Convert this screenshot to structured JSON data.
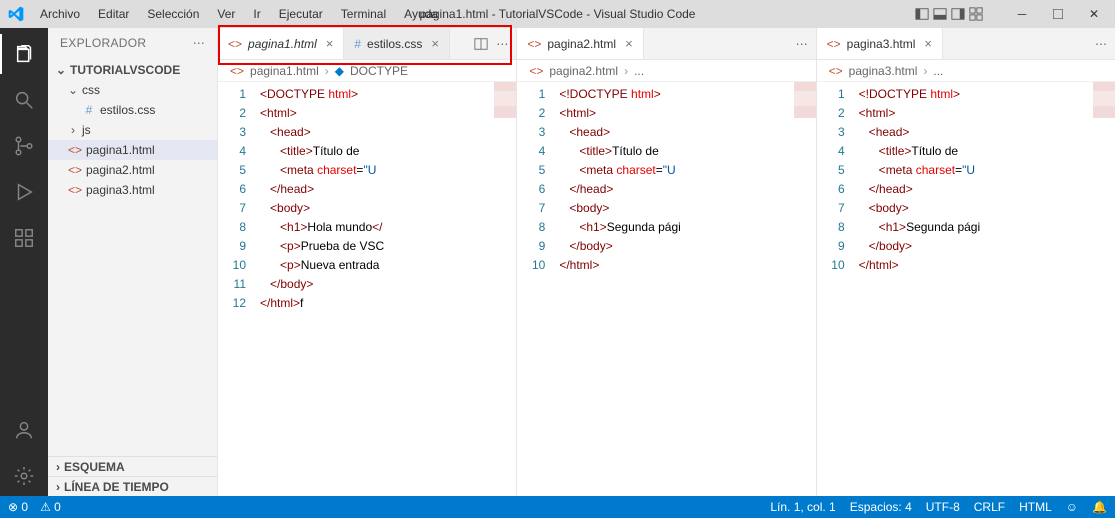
{
  "menu": {
    "items": [
      "Archivo",
      "Editar",
      "Selección",
      "Ver",
      "Ir",
      "Ejecutar",
      "Terminal",
      "Ayuda"
    ]
  },
  "window_title": "pagina1.html - TutorialVSCode - Visual Studio Code",
  "sidebar": {
    "title": "EXPLORADOR",
    "root": "TUTORIALVSCODE",
    "css_folder": "css",
    "css_file": "estilos.css",
    "js_folder": "js",
    "files": [
      "pagina1.html",
      "pagina2.html",
      "pagina3.html"
    ],
    "sections": [
      "ESQUEMA",
      "LÍNEA DE TIEMPO"
    ]
  },
  "group1": {
    "tabs": [
      {
        "label": "pagina1.html",
        "italic": true
      },
      {
        "label": "estilos.css",
        "italic": false
      }
    ],
    "breadcrumb": {
      "file": "pagina1.html",
      "sym": "DOCTYPE"
    },
    "code": [
      {
        "n": "1",
        "h": "<span class='t-ang'>&lt;</span><span class='t-tag'>DOCTYPE</span> <span class='t-attr'>html</span><span class='t-ang'>&gt;</span>"
      },
      {
        "n": "2",
        "h": "<span class='t-ang'>&lt;</span><span class='t-tag'>html</span><span class='t-ang'>&gt;</span>"
      },
      {
        "n": "3",
        "h": "   <span class='t-ang'>&lt;</span><span class='t-tag'>head</span><span class='t-ang'>&gt;</span>"
      },
      {
        "n": "4",
        "h": "      <span class='t-ang'>&lt;</span><span class='t-tag'>title</span><span class='t-ang'>&gt;</span><span class='t-txt'>Título de</span>"
      },
      {
        "n": "5",
        "h": "      <span class='t-ang'>&lt;</span><span class='t-tag'>meta</span> <span class='t-attr'>charset</span>=<span class='t-str'>\"U</span>"
      },
      {
        "n": "6",
        "h": "   <span class='t-ang'>&lt;/</span><span class='t-tag'>head</span><span class='t-ang'>&gt;</span>"
      },
      {
        "n": "7",
        "h": "   <span class='t-ang'>&lt;</span><span class='t-tag'>body</span><span class='t-ang'>&gt;</span>"
      },
      {
        "n": "8",
        "h": "      <span class='t-ang'>&lt;</span><span class='t-tag'>h1</span><span class='t-ang'>&gt;</span><span class='t-txt'>Hola mundo</span><span class='t-ang'>&lt;/</span>"
      },
      {
        "n": "9",
        "h": "      <span class='t-ang'>&lt;</span><span class='t-tag'>p</span><span class='t-ang'>&gt;</span><span class='t-txt'>Prueba de VSC</span>"
      },
      {
        "n": "10",
        "h": "      <span class='t-ang'>&lt;</span><span class='t-tag'>p</span><span class='t-ang'>&gt;</span><span class='t-txt'>Nueva entrada</span>"
      },
      {
        "n": "11",
        "h": "   <span class='t-ang'>&lt;/</span><span class='t-tag'>body</span><span class='t-ang'>&gt;</span>"
      },
      {
        "n": "12",
        "h": "<span class='t-ang'>&lt;/</span><span class='t-tag'>html</span><span class='t-ang'>&gt;</span><span class='t-txt'>f</span>"
      }
    ]
  },
  "group2": {
    "tabs": [
      {
        "label": "pagina2.html",
        "italic": false
      }
    ],
    "breadcrumb": {
      "file": "pagina2.html",
      "sym": "..."
    },
    "code": [
      {
        "n": "1",
        "h": "<span class='t-ang'>&lt;</span><span class='t-tag'>!DOCTYPE</span> <span class='t-attr'>html</span><span class='t-ang'>&gt;</span>"
      },
      {
        "n": "2",
        "h": "<span class='t-ang'>&lt;</span><span class='t-tag'>html</span><span class='t-ang'>&gt;</span>"
      },
      {
        "n": "3",
        "h": "   <span class='t-ang'>&lt;</span><span class='t-tag'>head</span><span class='t-ang'>&gt;</span>"
      },
      {
        "n": "4",
        "h": "      <span class='t-ang'>&lt;</span><span class='t-tag'>title</span><span class='t-ang'>&gt;</span><span class='t-txt'>Título de</span>"
      },
      {
        "n": "5",
        "h": "      <span class='t-ang'>&lt;</span><span class='t-tag'>meta</span> <span class='t-attr'>charset</span>=<span class='t-str'>\"U</span>"
      },
      {
        "n": "6",
        "h": "   <span class='t-ang'>&lt;/</span><span class='t-tag'>head</span><span class='t-ang'>&gt;</span>"
      },
      {
        "n": "7",
        "h": "   <span class='t-ang'>&lt;</span><span class='t-tag'>body</span><span class='t-ang'>&gt;</span>"
      },
      {
        "n": "8",
        "h": "      <span class='t-ang'>&lt;</span><span class='t-tag'>h1</span><span class='t-ang'>&gt;</span><span class='t-txt'>Segunda pági</span>"
      },
      {
        "n": "9",
        "h": "   <span class='t-ang'>&lt;/</span><span class='t-tag'>body</span><span class='t-ang'>&gt;</span>"
      },
      {
        "n": "10",
        "h": "<span class='t-ang'>&lt;/</span><span class='t-tag'>html</span><span class='t-ang'>&gt;</span>"
      }
    ]
  },
  "group3": {
    "tabs": [
      {
        "label": "pagina3.html",
        "italic": false
      }
    ],
    "breadcrumb": {
      "file": "pagina3.html",
      "sym": "..."
    },
    "code": [
      {
        "n": "1",
        "h": "<span class='t-ang'>&lt;</span><span class='t-tag'>!DOCTYPE</span> <span class='t-attr'>html</span><span class='t-ang'>&gt;</span>"
      },
      {
        "n": "2",
        "h": "<span class='t-ang'>&lt;</span><span class='t-tag'>html</span><span class='t-ang'>&gt;</span>"
      },
      {
        "n": "3",
        "h": "   <span class='t-ang'>&lt;</span><span class='t-tag'>head</span><span class='t-ang'>&gt;</span>"
      },
      {
        "n": "4",
        "h": "      <span class='t-ang'>&lt;</span><span class='t-tag'>title</span><span class='t-ang'>&gt;</span><span class='t-txt'>Título de</span>"
      },
      {
        "n": "5",
        "h": "      <span class='t-ang'>&lt;</span><span class='t-tag'>meta</span> <span class='t-attr'>charset</span>=<span class='t-str'>\"U</span>"
      },
      {
        "n": "6",
        "h": "   <span class='t-ang'>&lt;/</span><span class='t-tag'>head</span><span class='t-ang'>&gt;</span>"
      },
      {
        "n": "7",
        "h": "   <span class='t-ang'>&lt;</span><span class='t-tag'>body</span><span class='t-ang'>&gt;</span>"
      },
      {
        "n": "8",
        "h": "      <span class='t-ang'>&lt;</span><span class='t-tag'>h1</span><span class='t-ang'>&gt;</span><span class='t-txt'>Segunda pági</span>"
      },
      {
        "n": "9",
        "h": "   <span class='t-ang'>&lt;/</span><span class='t-tag'>body</span><span class='t-ang'>&gt;</span>"
      },
      {
        "n": "10",
        "h": "<span class='t-ang'>&lt;/</span><span class='t-tag'>html</span><span class='t-ang'>&gt;</span>"
      }
    ]
  },
  "status": {
    "errors": "0",
    "warnings": "0",
    "ln": "Lín. 1, col. 1",
    "spaces": "Espacios: 4",
    "enc": "UTF-8",
    "eol": "CRLF",
    "lang": "HTML"
  }
}
